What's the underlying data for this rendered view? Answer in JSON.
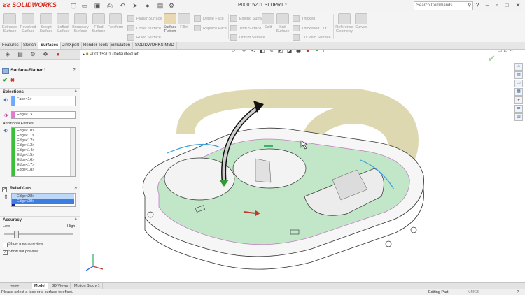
{
  "app": {
    "brand": "SOLIDWORKS",
    "doc_title": "P00015201.SLDPRT *"
  },
  "search": {
    "placeholder": "Search Commands"
  },
  "toolbar": {
    "large_tools": [
      {
        "label": "Extruded\nSurface",
        "icon": "extruded-surface-icon"
      },
      {
        "label": "Revolved\nSurface",
        "icon": "revolved-surface-icon"
      },
      {
        "label": "Swept\nSurface",
        "icon": "swept-surface-icon"
      },
      {
        "label": "Lofted\nSurface",
        "icon": "lofted-surface-icon"
      },
      {
        "label": "Boundary\nSurface",
        "icon": "boundary-surface-icon"
      },
      {
        "label": "Filled\nSurface",
        "icon": "filled-surface-icon"
      },
      {
        "label": "Freeform",
        "icon": "freeform-icon"
      },
      {
        "label": "Surface\nFlatten",
        "icon": "surface-flatten-icon"
      },
      {
        "label": "Fillet",
        "icon": "fillet-icon"
      },
      {
        "label": "Untrim\nSurface",
        "icon": "untrim-icon"
      },
      {
        "label": "Split",
        "icon": "split-icon"
      },
      {
        "label": "Knit\nSurface",
        "icon": "knit-icon"
      },
      {
        "label": "Reference\nGeometry",
        "icon": "reference-geometry-icon"
      },
      {
        "label": "Curves",
        "icon": "curves-icon"
      }
    ],
    "small_tools": [
      {
        "label": "Planar Surface",
        "icon": "planar-surface-icon"
      },
      {
        "label": "Offset Surface",
        "icon": "offset-surface-icon"
      },
      {
        "label": "Ruled Surface",
        "icon": "ruled-surface-icon"
      },
      {
        "label": "Delete Face",
        "icon": "delete-face-icon"
      },
      {
        "label": "Replace Face",
        "icon": "replace-face-icon"
      },
      {
        "label": "Extend Surface",
        "icon": "extend-surface-icon"
      },
      {
        "label": "Trim Surface",
        "icon": "trim-surface-icon"
      },
      {
        "label": "Thicken",
        "icon": "thicken-icon"
      },
      {
        "label": "Thickened Cut",
        "icon": "thickened-cut-icon"
      },
      {
        "label": "Cut With Surface",
        "icon": "cut-with-surface-icon"
      }
    ]
  },
  "tabs": [
    "Features",
    "Sketch",
    "Surfaces",
    "DimXpert",
    "Render Tools",
    "Simulation",
    "SOLIDWORKS MBD"
  ],
  "active_tab": "Surfaces",
  "property_manager": {
    "title": "Surface-Flatten1",
    "help": "?",
    "ok": "✔",
    "cancel": "✖",
    "selections_header": "Selections",
    "face_field": "Face<1>",
    "edge_field": "Edge<1>",
    "additional_label": "Additional Entities:",
    "additional_items": [
      "Edge<10>",
      "Edge<11>",
      "Edge<12>",
      "Edge<13>",
      "Edge<14>",
      "Edge<15>",
      "Edge<16>",
      "Edge<17>",
      "Edge<18>"
    ],
    "relief_header": "Relief Cuts",
    "relief_items": [
      "Edge<28>",
      "Edge<30>"
    ],
    "accuracy_header": "Accuracy",
    "low": "Low",
    "high": "High",
    "accuracy_level": 0.15,
    "show_mesh": "Show mesh preview",
    "show_flat": "Show flat preview",
    "show_mesh_checked": false,
    "show_flat_checked": true
  },
  "viewport": {
    "tree_label": "P00015201 (Default<<Def..."
  },
  "bottom_tabs": [
    "Model",
    "3D Views",
    "Motion Study 1"
  ],
  "active_bottom_tab": "Model",
  "status": {
    "message": "Please select a face or a surface to offset.",
    "mode": "Editing Part",
    "units": "MMGS"
  }
}
